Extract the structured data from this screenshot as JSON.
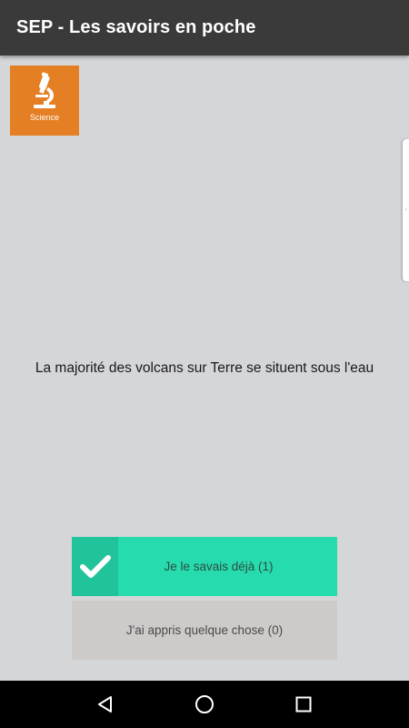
{
  "appbar": {
    "title": "SEP - Les savoirs en poche"
  },
  "category": {
    "label": "Science",
    "icon": "microscope-icon",
    "color": "#e57f23"
  },
  "fact": {
    "text": "La majorité des volcans sur Terre se situent sous l'eau"
  },
  "actions": {
    "knew": {
      "label": "Je le savais déjà (1)",
      "icon": "checkmark-icon",
      "color": "#26dbad"
    },
    "learned": {
      "label": "J'ai appris quelque chose (0)",
      "color": "#cdcbca"
    }
  },
  "navbar": {
    "back_icon": "back-triangle-icon",
    "home_icon": "home-circle-icon",
    "recents_icon": "recents-square-icon"
  }
}
